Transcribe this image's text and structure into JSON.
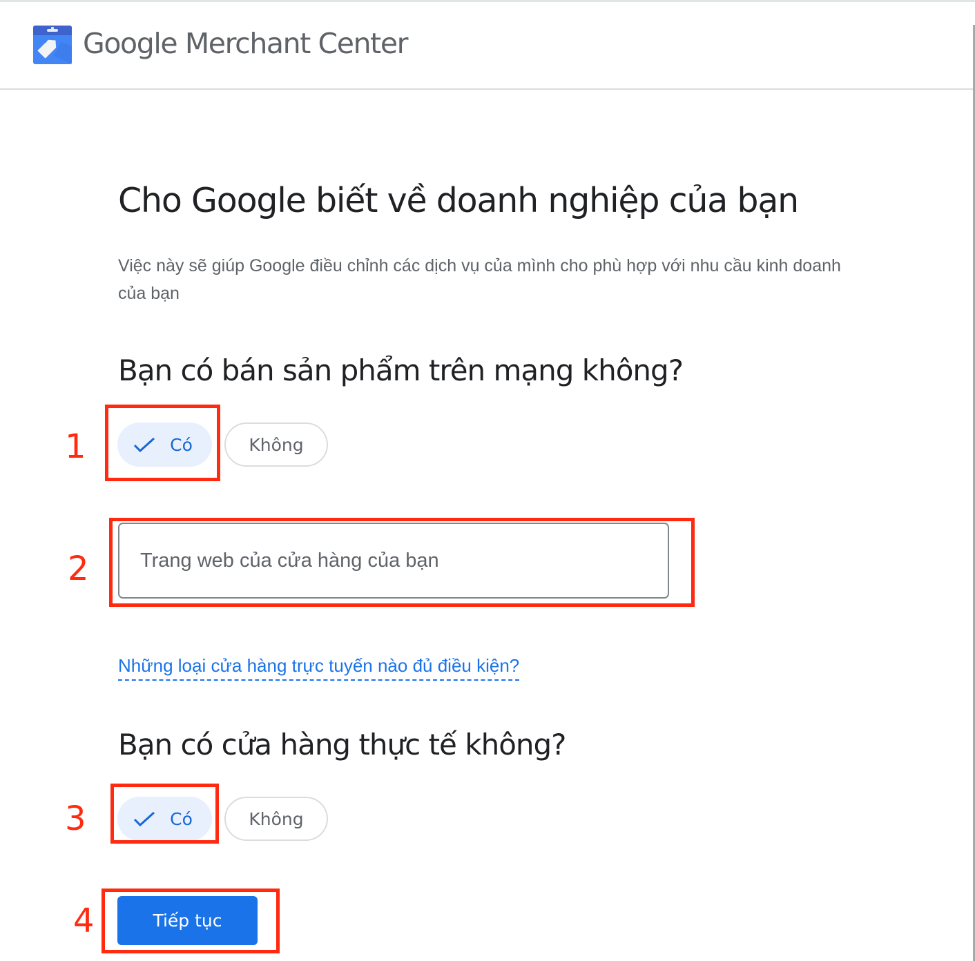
{
  "header": {
    "logo_icon": "merchant-center-tag-icon",
    "app_title_brand": "Google",
    "app_title_product": "Merchant Center"
  },
  "main": {
    "title": "Cho Google biết về doanh nghiệp của bạn",
    "subtitle": "Việc này sẽ giúp Google điều chỉnh các dịch vụ của mình cho phù hợp với nhu cầu kinh doanh của bạn",
    "online_question": {
      "label": "Bạn có bán sản phẩm trên mạng không?",
      "options": [
        {
          "label": "Có",
          "selected": true,
          "icon": "check-icon"
        },
        {
          "label": "Không",
          "selected": false
        }
      ]
    },
    "store_website_input": {
      "value": "",
      "placeholder": "Trang web của cửa hàng của bạn"
    },
    "eligibility_link": "Những loại cửa hàng trực tuyến nào đủ điều kiện?",
    "physical_store_question": {
      "label": "Bạn có cửa hàng thực tế không?",
      "options": [
        {
          "label": "Có",
          "selected": true,
          "icon": "check-icon"
        },
        {
          "label": "Không",
          "selected": false
        }
      ]
    },
    "continue_button": "Tiếp tục"
  },
  "annotations": {
    "color": "#ff2a0f",
    "markers": [
      "1",
      "2",
      "3",
      "4"
    ]
  },
  "colors": {
    "primary": "#1a73e8",
    "selected_chip_bg": "#e8f0fe",
    "selected_chip_text": "#1967d2",
    "secondary_text": "#5f6368"
  }
}
